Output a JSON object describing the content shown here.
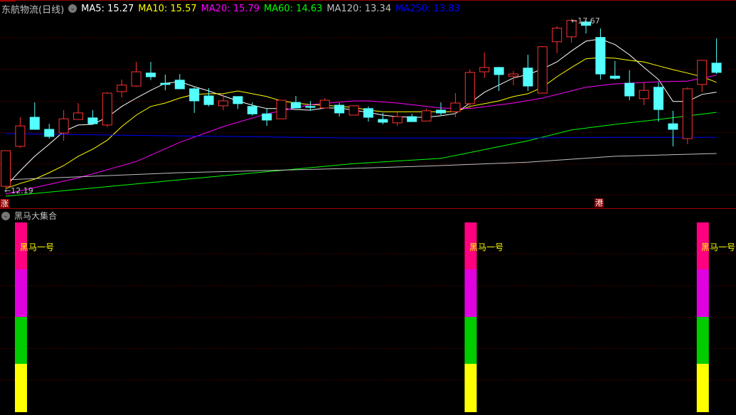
{
  "header": {
    "title": "东航物流(日线)",
    "ma_labels": [
      {
        "text": "MA5: 15.27",
        "color": "#ffffff"
      },
      {
        "text": "MA10: 15.57",
        "color": "#ffff00"
      },
      {
        "text": "MA20: 15.79",
        "color": "#ff00ff"
      },
      {
        "text": "MA60: 14.63",
        "color": "#00ff00"
      },
      {
        "text": "MA120: 13.34",
        "color": "#c0c0c0"
      },
      {
        "text": "MA250: 13.83",
        "color": "#0000ff"
      }
    ]
  },
  "badges": {
    "rise": "涨",
    "hk": "港"
  },
  "sub_panel": {
    "title": "黑马大集合",
    "signal_label": "黑马一号",
    "colors": [
      "#ff0080",
      "#e000e0",
      "#00cc00",
      "#ffff00"
    ]
  },
  "chart_data": {
    "type": "candlestick",
    "up_color": "#ff3232",
    "down_color": "#54ffff",
    "ylim": [
      11.62,
      18.28
    ],
    "grid": true,
    "annotations": {
      "low": "12.19",
      "high": "17.67"
    },
    "candles_ohlc": [
      [
        12.26,
        13.41,
        12.19,
        13.41
      ],
      [
        13.55,
        14.49,
        13.5,
        14.21
      ],
      [
        14.49,
        14.97,
        14.1,
        14.1
      ],
      [
        14.1,
        14.28,
        13.8,
        13.87
      ],
      [
        13.98,
        14.72,
        13.73,
        14.44
      ],
      [
        14.42,
        14.95,
        14.42,
        14.63
      ],
      [
        14.47,
        14.72,
        14.28,
        14.28
      ],
      [
        14.24,
        15.3,
        14.17,
        15.27
      ],
      [
        15.32,
        15.71,
        15.13,
        15.53
      ],
      [
        15.5,
        16.28,
        15.48,
        15.96
      ],
      [
        15.92,
        16.28,
        15.69,
        15.8
      ],
      [
        15.59,
        15.87,
        15.36,
        15.55
      ],
      [
        15.69,
        15.89,
        15.41,
        15.41
      ],
      [
        15.41,
        15.46,
        14.63,
        15.02
      ],
      [
        15.18,
        15.43,
        14.84,
        14.9
      ],
      [
        14.86,
        15.25,
        14.72,
        15.02
      ],
      [
        15.16,
        15.16,
        14.76,
        14.93
      ],
      [
        14.84,
        14.97,
        14.54,
        14.6
      ],
      [
        14.6,
        14.79,
        14.21,
        14.4
      ],
      [
        14.44,
        15.04,
        14.44,
        15.04
      ],
      [
        14.97,
        15.18,
        14.79,
        14.79
      ],
      [
        14.84,
        15.02,
        14.7,
        14.81
      ],
      [
        14.79,
        15.11,
        14.79,
        15.04
      ],
      [
        14.88,
        14.95,
        14.51,
        14.63
      ],
      [
        14.56,
        14.88,
        14.56,
        14.86
      ],
      [
        14.77,
        14.84,
        14.35,
        14.49
      ],
      [
        14.42,
        14.63,
        14.26,
        14.33
      ],
      [
        14.31,
        14.65,
        14.21,
        14.51
      ],
      [
        14.51,
        14.6,
        14.35,
        14.35
      ],
      [
        14.37,
        14.77,
        14.37,
        14.7
      ],
      [
        14.72,
        14.97,
        14.56,
        14.63
      ],
      [
        14.67,
        15.27,
        14.49,
        14.95
      ],
      [
        14.93,
        16.03,
        14.79,
        15.94
      ],
      [
        15.96,
        16.58,
        15.76,
        16.1
      ],
      [
        16.1,
        16.12,
        15.34,
        15.87
      ],
      [
        15.82,
        15.99,
        15.52,
        15.89
      ],
      [
        16.08,
        16.51,
        15.34,
        15.5
      ],
      [
        15.27,
        16.79,
        15.27,
        16.77
      ],
      [
        16.93,
        17.43,
        16.56,
        17.37
      ],
      [
        17.09,
        17.67,
        16.9,
        17.62
      ],
      [
        17.57,
        17.62,
        17.2,
        17.46
      ],
      [
        17.07,
        17.36,
        15.71,
        15.89
      ],
      [
        15.82,
        16.31,
        15.71,
        15.75
      ],
      [
        15.59,
        16.01,
        15.04,
        15.18
      ],
      [
        15.09,
        15.62,
        14.88,
        15.36
      ],
      [
        15.46,
        15.62,
        14.35,
        14.74
      ],
      [
        14.28,
        14.7,
        13.55,
        14.1
      ],
      [
        13.8,
        15.46,
        13.62,
        15.41
      ],
      [
        15.55,
        16.33,
        15.3,
        16.33
      ],
      [
        16.24,
        17.04,
        15.89,
        15.94
      ]
    ],
    "ma_series": [
      {
        "name": "MA5",
        "color": "#ffffff",
        "points": [
          [
            1,
            12.26
          ],
          [
            2,
            12.76
          ],
          [
            3,
            13.23
          ],
          [
            4,
            13.62
          ],
          [
            5,
            14.03
          ],
          [
            6,
            14.24
          ],
          [
            7,
            14.26
          ],
          [
            8,
            14.49
          ],
          [
            9,
            14.84
          ],
          [
            10,
            15.11
          ],
          [
            11,
            15.36
          ],
          [
            12,
            15.59
          ],
          [
            13,
            15.64
          ],
          [
            14,
            15.48
          ],
          [
            15,
            15.34
          ],
          [
            16,
            15.18
          ],
          [
            17,
            15.02
          ],
          [
            18,
            14.88
          ],
          [
            19,
            14.77
          ],
          [
            20,
            14.77
          ],
          [
            21,
            14.74
          ],
          [
            22,
            14.72
          ],
          [
            23,
            14.79
          ],
          [
            24,
            14.79
          ],
          [
            25,
            14.72
          ],
          [
            26,
            14.65
          ],
          [
            27,
            14.56
          ],
          [
            28,
            14.51
          ],
          [
            29,
            14.49
          ],
          [
            30,
            14.49
          ],
          [
            31,
            14.54
          ],
          [
            32,
            14.61
          ],
          [
            33,
            14.95
          ],
          [
            34,
            15.3
          ],
          [
            35,
            15.53
          ],
          [
            36,
            15.76
          ],
          [
            37,
            15.87
          ],
          [
            38,
            16.05
          ],
          [
            39,
            16.28
          ],
          [
            40,
            16.63
          ],
          [
            41,
            16.95
          ],
          [
            42,
            17.02
          ],
          [
            43,
            16.84
          ],
          [
            44,
            16.51
          ],
          [
            45,
            16.1
          ],
          [
            46,
            15.71
          ],
          [
            47,
            15.0
          ],
          [
            48,
            15.0
          ],
          [
            49,
            15.23
          ],
          [
            50,
            15.3
          ]
        ]
      },
      {
        "name": "MA10",
        "color": "#ffff00",
        "points": [
          [
            1,
            12.19
          ],
          [
            2,
            12.35
          ],
          [
            3,
            12.49
          ],
          [
            4,
            12.7
          ],
          [
            5,
            12.93
          ],
          [
            6,
            13.23
          ],
          [
            7,
            13.46
          ],
          [
            8,
            13.75
          ],
          [
            9,
            14.19
          ],
          [
            10,
            14.56
          ],
          [
            11,
            14.84
          ],
          [
            12,
            14.95
          ],
          [
            13,
            15.11
          ],
          [
            14,
            15.23
          ],
          [
            15,
            15.25
          ],
          [
            16,
            15.25
          ],
          [
            17,
            15.34
          ],
          [
            18,
            15.25
          ],
          [
            19,
            15.16
          ],
          [
            20,
            15.02
          ],
          [
            21,
            14.95
          ],
          [
            22,
            14.9
          ],
          [
            23,
            14.88
          ],
          [
            24,
            14.84
          ],
          [
            25,
            14.81
          ],
          [
            26,
            14.72
          ],
          [
            27,
            14.67
          ],
          [
            32,
            14.67
          ],
          [
            33,
            14.84
          ],
          [
            34,
            14.93
          ],
          [
            35,
            15.02
          ],
          [
            36,
            15.16
          ],
          [
            37,
            15.25
          ],
          [
            38,
            15.46
          ],
          [
            39,
            15.8
          ],
          [
            40,
            16.1
          ],
          [
            41,
            16.38
          ],
          [
            42,
            16.42
          ],
          [
            43,
            16.4
          ],
          [
            44,
            16.33
          ],
          [
            45,
            16.28
          ],
          [
            46,
            16.15
          ],
          [
            47,
            16.03
          ],
          [
            48,
            15.92
          ],
          [
            49,
            15.8
          ],
          [
            50,
            15.62
          ]
        ]
      },
      {
        "name": "MA20",
        "color": "#ff00ff",
        "points": [
          [
            1,
            12.01
          ],
          [
            6,
            12.53
          ],
          [
            10,
            13.06
          ],
          [
            13,
            13.68
          ],
          [
            16,
            14.19
          ],
          [
            19,
            14.6
          ],
          [
            22,
            14.9
          ],
          [
            25,
            15.02
          ],
          [
            26,
            15.02
          ],
          [
            28,
            14.95
          ],
          [
            31,
            14.79
          ],
          [
            33,
            14.77
          ],
          [
            36,
            14.95
          ],
          [
            38,
            15.11
          ],
          [
            41,
            15.46
          ],
          [
            43,
            15.57
          ],
          [
            46,
            15.64
          ],
          [
            48,
            15.66
          ],
          [
            50,
            15.85
          ]
        ]
      },
      {
        "name": "MA60",
        "color": "#00ff00",
        "points": [
          [
            1,
            11.94
          ],
          [
            13,
            12.47
          ],
          [
            25,
            12.99
          ],
          [
            31,
            13.16
          ],
          [
            37,
            13.73
          ],
          [
            40,
            14.08
          ],
          [
            43,
            14.26
          ],
          [
            46,
            14.42
          ],
          [
            50,
            14.65
          ]
        ]
      },
      {
        "name": "MA120",
        "color": "#c0c0c0",
        "points": [
          [
            1,
            12.47
          ],
          [
            13,
            12.7
          ],
          [
            25,
            12.84
          ],
          [
            31,
            12.93
          ],
          [
            37,
            13.04
          ],
          [
            43,
            13.23
          ],
          [
            50,
            13.32
          ]
        ]
      },
      {
        "name": "MA250",
        "color": "#0000ff",
        "points": [
          [
            1,
            13.96
          ],
          [
            13,
            13.89
          ],
          [
            25,
            13.82
          ],
          [
            37,
            13.82
          ],
          [
            43,
            13.84
          ],
          [
            50,
            13.84
          ]
        ]
      }
    ],
    "signal_candles": [
      1,
      32,
      48
    ]
  }
}
